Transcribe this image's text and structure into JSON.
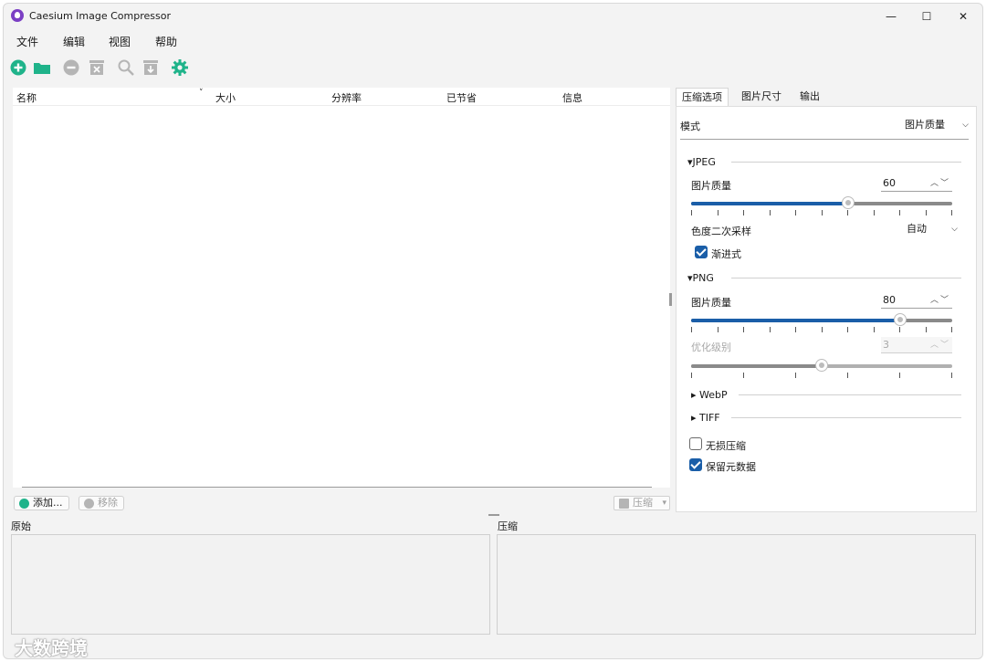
{
  "window": {
    "title": "Caesium Image Compressor",
    "minimize_glyph": "—",
    "maximize_glyph": "☐",
    "close_glyph": "✕"
  },
  "menu": [
    "文件",
    "编辑",
    "视图",
    "帮助"
  ],
  "toolbar": {
    "icons": [
      "add-icon",
      "open-folder-icon",
      "remove-icon",
      "clear-icon",
      "search-icon",
      "import-icon",
      "settings-icon"
    ],
    "accent": "#1fb38a",
    "disabled_color": "#b5b5b5"
  },
  "file_list": {
    "columns": [
      "名称",
      "大小",
      "分辨率",
      "已节省",
      "信息"
    ]
  },
  "actions": {
    "add_label": "添加...",
    "remove_label": "移除",
    "compress_label": "压缩"
  },
  "panels": {
    "original_label": "原始",
    "compressed_label": "压缩"
  },
  "tabs": [
    "压缩选项",
    "图片尺寸",
    "输出"
  ],
  "options": {
    "mode_label": "模式",
    "mode_value": "图片质量",
    "jpeg": {
      "header": "▾JPEG",
      "quality_label": "图片质量",
      "quality_value": "60",
      "quality": 60,
      "chroma_label": "色度二次采样",
      "chroma_value": "自动",
      "progressive_label": "渐进式",
      "progressive": true
    },
    "png": {
      "header": "▾PNG",
      "quality_label": "图片质量",
      "quality_value": "80",
      "quality": 80,
      "optimize_label": "优化级别",
      "optimize_value": "3",
      "optimize_level": 3,
      "optimize_max": 6
    },
    "webp_header": "▸ WebP",
    "tiff_header": "▸ TIFF",
    "lossless_label": "无损压缩",
    "lossless": false,
    "keep_metadata_label": "保留元数据",
    "keep_metadata": true
  },
  "watermark": "大数跨境",
  "colors": {
    "accent_blue": "#1a5ea8",
    "accent_green": "#1fb38a"
  }
}
